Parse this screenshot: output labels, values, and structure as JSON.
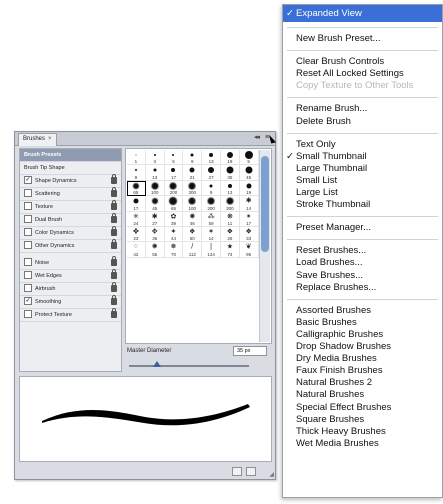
{
  "panel": {
    "tab_label": "Brushes",
    "close_glyph": "×",
    "collapse_glyph": "◂◂",
    "menu_glyph": "≡",
    "sidebar": [
      {
        "label": "Brush Presets",
        "type": "header",
        "active": true
      },
      {
        "label": "Brush Tip Shape",
        "type": "plain"
      },
      {
        "label": "Shape Dynamics",
        "type": "option",
        "checked": true,
        "lock": true
      },
      {
        "label": "Scattering",
        "type": "option",
        "checked": false,
        "lock": true
      },
      {
        "label": "Texture",
        "type": "option",
        "checked": false,
        "lock": true
      },
      {
        "label": "Dual Brush",
        "type": "option",
        "checked": false,
        "lock": true
      },
      {
        "label": "Color Dynamics",
        "type": "option",
        "checked": false,
        "lock": true
      },
      {
        "label": "Other Dynamics",
        "type": "option",
        "checked": false,
        "lock": true
      },
      {
        "label": "Noise",
        "type": "option",
        "checked": false,
        "lock": true,
        "gap": true
      },
      {
        "label": "Wet Edges",
        "type": "option",
        "checked": false,
        "lock": true
      },
      {
        "label": "Airbrush",
        "type": "option",
        "checked": false,
        "lock": true
      },
      {
        "label": "Smoothing",
        "type": "option",
        "checked": true,
        "lock": true
      },
      {
        "label": "Protect Texture",
        "type": "option",
        "checked": false,
        "lock": true
      }
    ],
    "brushes": [
      {
        "n": "1",
        "k": "dot",
        "s": 1
      },
      {
        "n": "3",
        "k": "dot",
        "s": 2
      },
      {
        "n": "5",
        "k": "dot",
        "s": 2
      },
      {
        "n": "9",
        "k": "dot",
        "s": 3
      },
      {
        "n": "13",
        "k": "dot",
        "s": 4
      },
      {
        "n": "19",
        "k": "dot",
        "s": 6
      },
      {
        "n": "5",
        "k": "dot",
        "s": 8
      },
      {
        "n": "9",
        "k": "dot",
        "s": 2
      },
      {
        "n": "13",
        "k": "dot",
        "s": 3
      },
      {
        "n": "17",
        "k": "dot",
        "s": 4
      },
      {
        "n": "21",
        "k": "dot",
        "s": 5
      },
      {
        "n": "27",
        "k": "dot",
        "s": 6
      },
      {
        "n": "35",
        "k": "dot",
        "s": 7
      },
      {
        "n": "45",
        "k": "dot",
        "s": 7
      },
      {
        "n": "65",
        "k": "dot",
        "s": 6
      },
      {
        "n": "100",
        "k": "dot",
        "s": 7
      },
      {
        "n": "200",
        "k": "dot",
        "s": 7
      },
      {
        "n": "300",
        "k": "dot",
        "s": 7
      },
      {
        "n": "9",
        "k": "dot",
        "s": 3
      },
      {
        "n": "13",
        "k": "dot",
        "s": 4
      },
      {
        "n": "19",
        "k": "dot",
        "s": 5
      },
      {
        "n": "17",
        "k": "dot",
        "s": 5
      },
      {
        "n": "45",
        "k": "dot",
        "s": 6
      },
      {
        "n": "65",
        "k": "dot",
        "s": 8
      },
      {
        "n": "100",
        "k": "dot",
        "s": 7
      },
      {
        "n": "200",
        "k": "dot",
        "s": 7
      },
      {
        "n": "300",
        "k": "dot",
        "s": 7
      },
      {
        "n": "14",
        "k": "tex",
        "g": "✱"
      },
      {
        "n": "24",
        "k": "tex",
        "g": "✳"
      },
      {
        "n": "27",
        "k": "tex",
        "g": "✱"
      },
      {
        "n": "39",
        "k": "tex",
        "g": "✿"
      },
      {
        "n": "46",
        "k": "tex",
        "g": "✺"
      },
      {
        "n": "59",
        "k": "tex",
        "g": "⁂"
      },
      {
        "n": "11",
        "k": "tex",
        "g": "❋"
      },
      {
        "n": "17",
        "k": "tex",
        "g": "✴"
      },
      {
        "n": "23",
        "k": "tex",
        "g": "✤"
      },
      {
        "n": "36",
        "k": "tex",
        "g": "✥"
      },
      {
        "n": "44",
        "k": "tex",
        "g": "✦"
      },
      {
        "n": "60",
        "k": "tex",
        "g": "❖"
      },
      {
        "n": "14",
        "k": "tex",
        "g": "✶"
      },
      {
        "n": "26",
        "k": "tex",
        "g": "❖"
      },
      {
        "n": "33",
        "k": "tex",
        "g": "❖"
      },
      {
        "n": "42",
        "k": "tex",
        "g": "⁘"
      },
      {
        "n": "55",
        "k": "tex",
        "g": "✺"
      },
      {
        "n": "70",
        "k": "tex",
        "g": "❅"
      },
      {
        "n": "112",
        "k": "tex",
        "g": "/"
      },
      {
        "n": "134",
        "k": "tex",
        "g": "|"
      },
      {
        "n": "74",
        "k": "tex",
        "g": "★"
      },
      {
        "n": "95",
        "k": "tex",
        "g": "❦"
      }
    ],
    "selected_brush_index": 14,
    "master_diameter_label": "Master Diameter",
    "master_diameter_value": "35 px",
    "master_diameter_fraction": 0.2
  },
  "menu": {
    "items": [
      {
        "label": "Expanded View",
        "checked": true,
        "highlighted": true
      },
      {
        "sep": true
      },
      {
        "label": "New Brush Preset..."
      },
      {
        "sep": true
      },
      {
        "label": "Clear Brush Controls"
      },
      {
        "label": "Reset All Locked Settings"
      },
      {
        "label": "Copy Texture to Other Tools",
        "disabled": true
      },
      {
        "sep": true
      },
      {
        "label": "Rename Brush..."
      },
      {
        "label": "Delete Brush"
      },
      {
        "sep": true
      },
      {
        "label": "Text Only"
      },
      {
        "label": "Small Thumbnail",
        "checked": true
      },
      {
        "label": "Large Thumbnail"
      },
      {
        "label": "Small List"
      },
      {
        "label": "Large List"
      },
      {
        "label": "Stroke Thumbnail"
      },
      {
        "sep": true
      },
      {
        "label": "Preset Manager..."
      },
      {
        "sep": true
      },
      {
        "label": "Reset Brushes..."
      },
      {
        "label": "Load Brushes..."
      },
      {
        "label": "Save Brushes..."
      },
      {
        "label": "Replace Brushes..."
      },
      {
        "sep": true
      },
      {
        "label": "Assorted Brushes"
      },
      {
        "label": "Basic Brushes"
      },
      {
        "label": "Calligraphic Brushes"
      },
      {
        "label": "Drop Shadow Brushes"
      },
      {
        "label": "Dry Media Brushes"
      },
      {
        "label": "Faux Finish Brushes"
      },
      {
        "label": "Natural Brushes 2"
      },
      {
        "label": "Natural Brushes"
      },
      {
        "label": "Special Effect Brushes"
      },
      {
        "label": "Square Brushes"
      },
      {
        "label": "Thick Heavy Brushes"
      },
      {
        "label": "Wet Media Brushes"
      }
    ],
    "check_glyph": "✓"
  }
}
